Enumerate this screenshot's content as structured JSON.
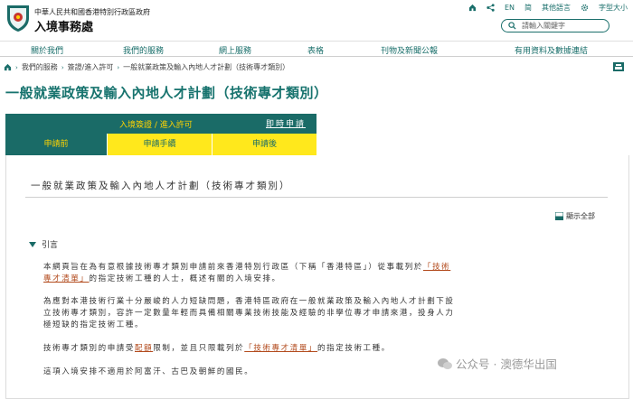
{
  "header": {
    "gov_name": "中華人民共和國香港特別行政區政府",
    "dept_name": "入境事務處",
    "utils": [
      "EN",
      "简",
      "其他語言",
      "字型大小"
    ],
    "icon_names": [
      "home-icon",
      "share-icon",
      "gear-icon"
    ],
    "search_placeholder": "請輸入關鍵字"
  },
  "nav": {
    "items": [
      "關於我們",
      "我們的服務",
      "網上服務",
      "表格",
      "刊物及新聞公報",
      "有用資料及數據連結"
    ]
  },
  "breadcrumb": {
    "items": [
      "我們的服務",
      "簽證/進入許可",
      "一般就業政策及輸入內地人才計劃（技術專才類別）"
    ]
  },
  "page": {
    "title": "一般就業政策及輸入內地人才計劃（技術專才類別）"
  },
  "tabs": {
    "category": "入境簽證 / 進入許可",
    "apply_now": "即時申請",
    "items": [
      "申請前",
      "申請手續",
      "申請後"
    ]
  },
  "content": {
    "panel_title": "一般就業政策及輸入內地人才計劃（技術專才類別）",
    "expand_all": "顯示全部",
    "section_title": "引言",
    "p1_line1": "本網頁旨在為有意根據技術專才類別申請前來香港特別行政區（下稱「香港特區」）從事載列於",
    "p1_link_a": "「技術",
    "p1_link_b": "專才清單」",
    "p1_line2_rest": "的指定技術工種的人士，概述有關的入境安排。",
    "p2_line1": "為應對本港技術行業十分嚴峻的人力短缺問題，香港特區政府在一般就業政策及輸入內地人才計劃下設",
    "p2_line2": "立技術專才類別，容許一定數量年輕而具備相關專業技術技能及經驗的非學位專才申請來港，投身人力",
    "p2_line3": "極短缺的指定技術工種。",
    "p3_pre": "技術專才類別的申請受",
    "p3_link1": "配額",
    "p3_mid": "限制，並且只限載列於",
    "p3_link2": "「技術專才清單」",
    "p3_post": "的指定技術工種。",
    "p4": "這項入境安排不適用於阿富汗、古巴及朝鮮的國民。"
  },
  "watermark": {
    "text": "公众号 · 澳德华出国"
  },
  "colors": {
    "brand_green": "#1a6b67",
    "tab_yellow": "#ffe81c",
    "tab_text_yellow": "#ffd300",
    "link": "#b24a1c"
  }
}
